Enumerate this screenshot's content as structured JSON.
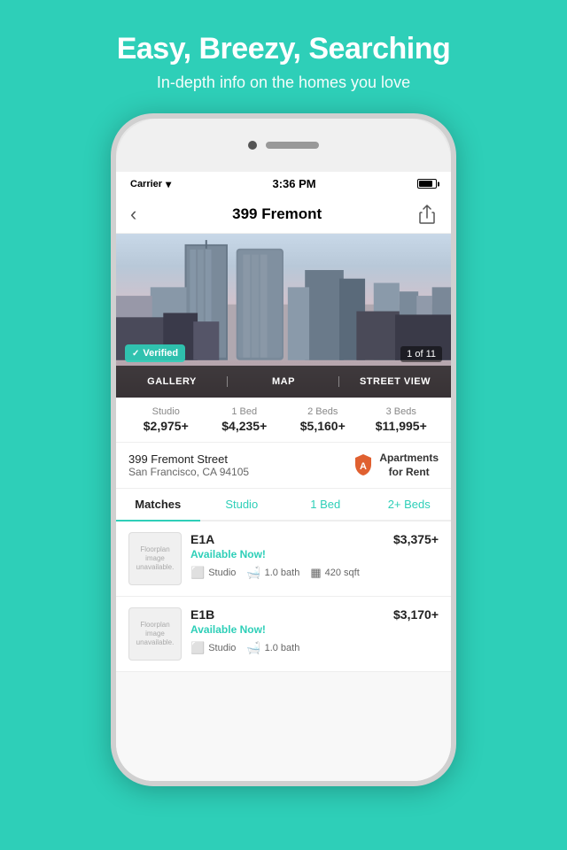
{
  "header": {
    "title": "Easy, Breezy, Searching",
    "subtitle": "In-depth info on the homes you love",
    "bg_color": "#2ECFB8"
  },
  "status_bar": {
    "carrier": "Carrier",
    "time": "3:36 PM"
  },
  "nav": {
    "title": "399 Fremont",
    "back_label": "‹"
  },
  "property": {
    "verified_label": "Verified",
    "image_counter": "1 of 11",
    "view_tabs": [
      "GALLERY",
      "MAP",
      "STREET VIEW"
    ]
  },
  "prices": [
    {
      "label": "Studio",
      "value": "$2,975+"
    },
    {
      "label": "1 Bed",
      "value": "$4,235+"
    },
    {
      "label": "2 Beds",
      "value": "$5,160+"
    },
    {
      "label": "3 Beds",
      "value": "$11,995+"
    }
  ],
  "address": {
    "street": "399 Fremont Street",
    "city": "San Francisco, CA 94105",
    "brand_name": "Apartments\nfor Rent"
  },
  "filter_tabs": [
    {
      "label": "Matches",
      "active": true
    },
    {
      "label": "Studio",
      "active": false,
      "teal": true
    },
    {
      "label": "1 Bed",
      "active": false,
      "teal": true
    },
    {
      "label": "2+ Beds",
      "active": false,
      "teal": true
    }
  ],
  "units": [
    {
      "id": "E1A",
      "thumbnail_text": "Floorplan image unavailable.",
      "availability": "Available Now!",
      "type": "Studio",
      "bath": "1.0 bath",
      "sqft": "420 sqft",
      "price": "$3,375+"
    },
    {
      "id": "E1B",
      "thumbnail_text": "Floorplan image unavailable.",
      "availability": "Available Now!",
      "type": "Studio",
      "bath": "1.0 bath",
      "sqft": "",
      "price": "$3,170+"
    }
  ]
}
